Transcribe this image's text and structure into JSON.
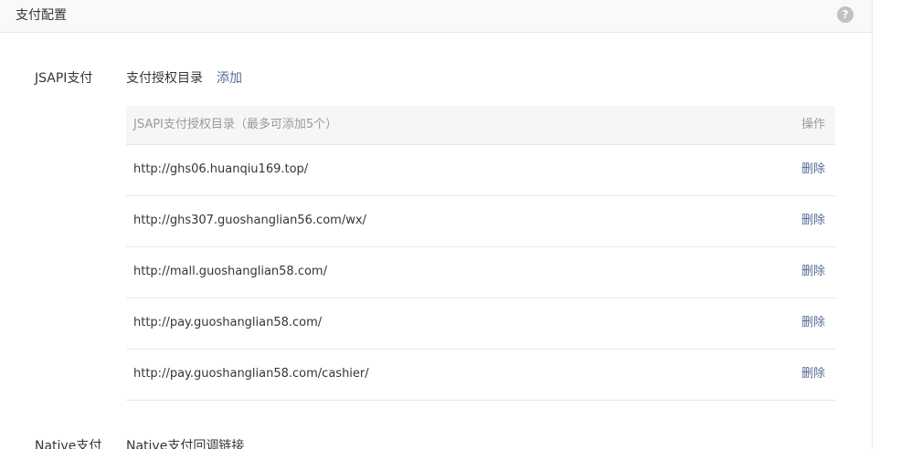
{
  "panel": {
    "title": "支付配置",
    "help_icon": "question-circle-icon"
  },
  "jsapi": {
    "label": "JSAPI支付",
    "sub_label": "支付授权目录",
    "add_label": "添加",
    "table": {
      "header_main": "JSAPI支付授权目录（最多可添加5个）",
      "header_op": "操作",
      "rows": [
        {
          "url": "http://ghs06.huanqiu169.top/",
          "action": "删除"
        },
        {
          "url": "http://ghs307.guoshanglian56.com/wx/",
          "action": "删除"
        },
        {
          "url": "http://mall.guoshanglian58.com/",
          "action": "删除"
        },
        {
          "url": "http://pay.guoshanglian58.com/",
          "action": "删除"
        },
        {
          "url": "http://pay.guoshanglian58.com/cashier/",
          "action": "删除"
        }
      ]
    }
  },
  "native": {
    "label": "Native支付",
    "sub_label": "Native支付回调链接"
  },
  "colors": {
    "link": "#576b95",
    "header_bg": "#f9f9f9",
    "table_header_bg": "#f6f6f6",
    "border": "#e7e7eb"
  }
}
